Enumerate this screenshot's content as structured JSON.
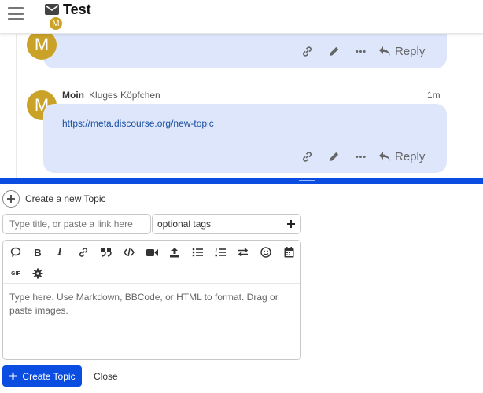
{
  "header": {
    "title": "Test",
    "avatar_letter": "M"
  },
  "posts": [
    {
      "avatar_letter": "M",
      "reply_label": "Reply"
    },
    {
      "avatar_letter": "M",
      "username": "Moin",
      "full_name": "Kluges Köpfchen",
      "time": "1m",
      "link_text": "https://meta.discourse.org/new-topic",
      "reply_label": "Reply"
    }
  ],
  "composer": {
    "create_title": "Create a new Topic",
    "title_placeholder": "Type title, or paste a link here",
    "tags_placeholder": "optional tags",
    "editor_placeholder": "Type here. Use Markdown, BBCode, or HTML to format. Drag or paste images.",
    "gif_label": "GIF",
    "create_button_label": "Create Topic",
    "close_label": "Close"
  },
  "colors": {
    "accent": "#0a4de0",
    "bubble": "#dde6fb",
    "avatar": "#c9a227"
  }
}
